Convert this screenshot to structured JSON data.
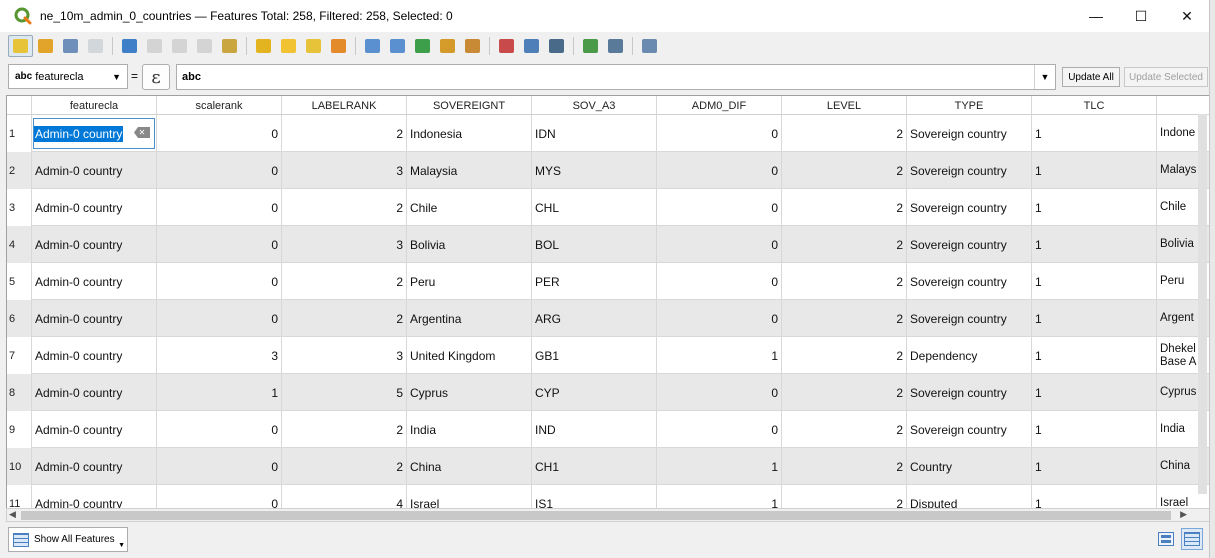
{
  "window": {
    "title": "ne_10m_admin_0_countries — Features Total: 258, Filtered: 258, Selected: 0",
    "minimize_label": "—",
    "maximize_label": "☐",
    "close_label": "✕"
  },
  "toolbar": {
    "icons": [
      {
        "name": "toggle-editing-icon",
        "color": "#e7c33a",
        "state": "active"
      },
      {
        "name": "multi-edit-icon",
        "color": "#e2a42a",
        "state": "normal"
      },
      {
        "name": "save-edits-icon",
        "color": "#6d8fb9",
        "state": "normal"
      },
      {
        "name": "reload-icon",
        "color": "#9aaab8",
        "state": "disabled"
      },
      {
        "name": "add-feature-icon",
        "color": "#3f7fc8",
        "state": "normal"
      },
      {
        "name": "delete-selected-icon",
        "color": "#a0a0a0",
        "state": "disabled"
      },
      {
        "name": "cut-icon",
        "color": "#a0a0a0",
        "state": "disabled"
      },
      {
        "name": "copy-icon",
        "color": "#a0a0a0",
        "state": "disabled"
      },
      {
        "name": "paste-icon",
        "color": "#c9a640",
        "state": "normal"
      },
      {
        "name": "select-by-expression-icon",
        "color": "#e3b41f",
        "state": "normal"
      },
      {
        "name": "select-all-icon",
        "color": "#f1c232",
        "state": "normal"
      },
      {
        "name": "invert-selection-icon",
        "color": "#e7c33a",
        "state": "normal"
      },
      {
        "name": "deselect-all-icon",
        "color": "#e38a2b",
        "state": "normal"
      },
      {
        "name": "filter-select-icon",
        "color": "#5a8fd0",
        "state": "normal"
      },
      {
        "name": "move-selection-top-icon",
        "color": "#5a8fd0",
        "state": "normal"
      },
      {
        "name": "pan-to-selected-icon",
        "color": "#3e9f4a",
        "state": "normal"
      },
      {
        "name": "zoom-to-selected-icon",
        "color": "#d49b2a",
        "state": "normal"
      },
      {
        "name": "new-field-icon",
        "color": "#c88a34",
        "state": "normal"
      },
      {
        "name": "delete-field-icon",
        "color": "#c84a4a",
        "state": "normal"
      },
      {
        "name": "organize-columns-icon",
        "color": "#4f7fb8",
        "state": "normal"
      },
      {
        "name": "field-calculator-icon",
        "color": "#4a6a8a",
        "state": "normal"
      },
      {
        "name": "conditional-formatting-icon",
        "color": "#4a9a4a",
        "state": "normal"
      },
      {
        "name": "actions-icon",
        "color": "#5a7a9a",
        "state": "normal"
      },
      {
        "name": "dock-icon",
        "color": "#6a8ab0",
        "state": "normal"
      }
    ]
  },
  "filter": {
    "field_type": "abc",
    "field_name": "featurecla",
    "equals": "=",
    "expression_symbol": "ε",
    "value": "abc",
    "update_all_label": "Update All",
    "update_selected_label": "Update Selected"
  },
  "table": {
    "columns": [
      "featurecla",
      "scalerank",
      "LABELRANK",
      "SOVEREIGNT",
      "SOV_A3",
      "ADM0_DIF",
      "LEVEL",
      "TYPE",
      "TLC",
      ""
    ],
    "rows": [
      {
        "id": "1",
        "cells": [
          "Admin-0 country",
          "0",
          "2",
          "Indonesia",
          "IDN",
          "0",
          "2",
          "Sovereign country",
          "1",
          "Indone"
        ]
      },
      {
        "id": "2",
        "cells": [
          "Admin-0 country",
          "0",
          "3",
          "Malaysia",
          "MYS",
          "0",
          "2",
          "Sovereign country",
          "1",
          "Malays"
        ]
      },
      {
        "id": "3",
        "cells": [
          "Admin-0 country",
          "0",
          "2",
          "Chile",
          "CHL",
          "0",
          "2",
          "Sovereign country",
          "1",
          "Chile"
        ]
      },
      {
        "id": "4",
        "cells": [
          "Admin-0 country",
          "0",
          "3",
          "Bolivia",
          "BOL",
          "0",
          "2",
          "Sovereign country",
          "1",
          "Bolivia"
        ]
      },
      {
        "id": "5",
        "cells": [
          "Admin-0 country",
          "0",
          "2",
          "Peru",
          "PER",
          "0",
          "2",
          "Sovereign country",
          "1",
          "Peru"
        ]
      },
      {
        "id": "6",
        "cells": [
          "Admin-0 country",
          "0",
          "2",
          "Argentina",
          "ARG",
          "0",
          "2",
          "Sovereign country",
          "1",
          "Argent"
        ]
      },
      {
        "id": "7",
        "cells": [
          "Admin-0 country",
          "3",
          "3",
          "United Kingdom",
          "GB1",
          "1",
          "2",
          "Dependency",
          "1",
          "Dhekel Base A"
        ]
      },
      {
        "id": "8",
        "cells": [
          "Admin-0 country",
          "1",
          "5",
          "Cyprus",
          "CYP",
          "0",
          "2",
          "Sovereign country",
          "1",
          "Cyprus"
        ]
      },
      {
        "id": "9",
        "cells": [
          "Admin-0 country",
          "0",
          "2",
          "India",
          "IND",
          "0",
          "2",
          "Sovereign country",
          "1",
          "India"
        ]
      },
      {
        "id": "10",
        "cells": [
          "Admin-0 country",
          "0",
          "2",
          "China",
          "CH1",
          "1",
          "2",
          "Country",
          "1",
          "China"
        ]
      },
      {
        "id": "11",
        "cells": [
          "Admin-0 country",
          "0",
          "4",
          "Israel",
          "IS1",
          "1",
          "2",
          "Disputed",
          "1",
          "Israel"
        ]
      }
    ]
  },
  "bottom": {
    "show_all_label": "Show All Features"
  }
}
